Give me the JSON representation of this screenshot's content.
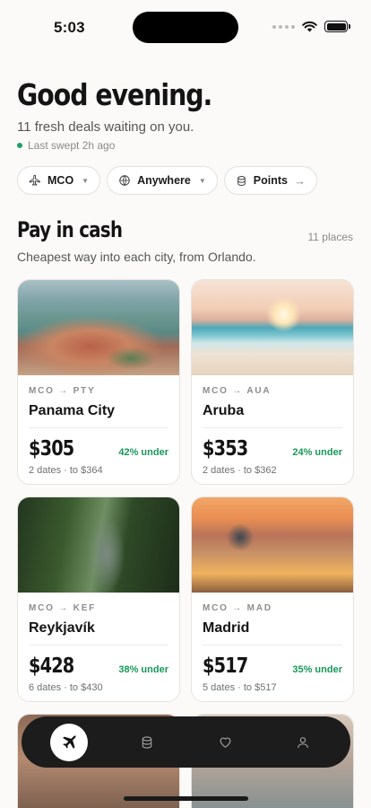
{
  "status": {
    "time": "5:03"
  },
  "header": {
    "greeting": "Good evening.",
    "subtitle": "11 fresh deals waiting on you.",
    "last_swept": "Last swept 2h ago"
  },
  "filters": {
    "origin": "MCO",
    "destination": "Anywhere",
    "points_label": "Points",
    "points_arrow": "→"
  },
  "section": {
    "title": "Pay in cash",
    "count": "11 places",
    "subtitle": "Cheapest way into each city, from Orlando."
  },
  "deals": [
    {
      "route": "MCO → PTY",
      "city": "Panama City",
      "price": "$305",
      "under": "42% under",
      "dates": "2 dates · to $364"
    },
    {
      "route": "MCO → AUA",
      "city": "Aruba",
      "price": "$353",
      "under": "24% under",
      "dates": "2 dates · to $362"
    },
    {
      "route": "MCO → KEF",
      "city": "Reykjavík",
      "price": "$428",
      "under": "38% under",
      "dates": "6 dates · to $430"
    },
    {
      "route": "MCO → MAD",
      "city": "Madrid",
      "price": "$517",
      "under": "35% under",
      "dates": "5 dates · to $517"
    }
  ],
  "colors": {
    "accent_green": "#17985a",
    "tabbar": "#1c1c1c",
    "background": "#fbfaf8"
  },
  "tabs": [
    {
      "icon": "plane-icon",
      "active": true
    },
    {
      "icon": "coins-icon",
      "active": false
    },
    {
      "icon": "heart-icon",
      "active": false
    },
    {
      "icon": "person-icon",
      "active": false
    }
  ]
}
